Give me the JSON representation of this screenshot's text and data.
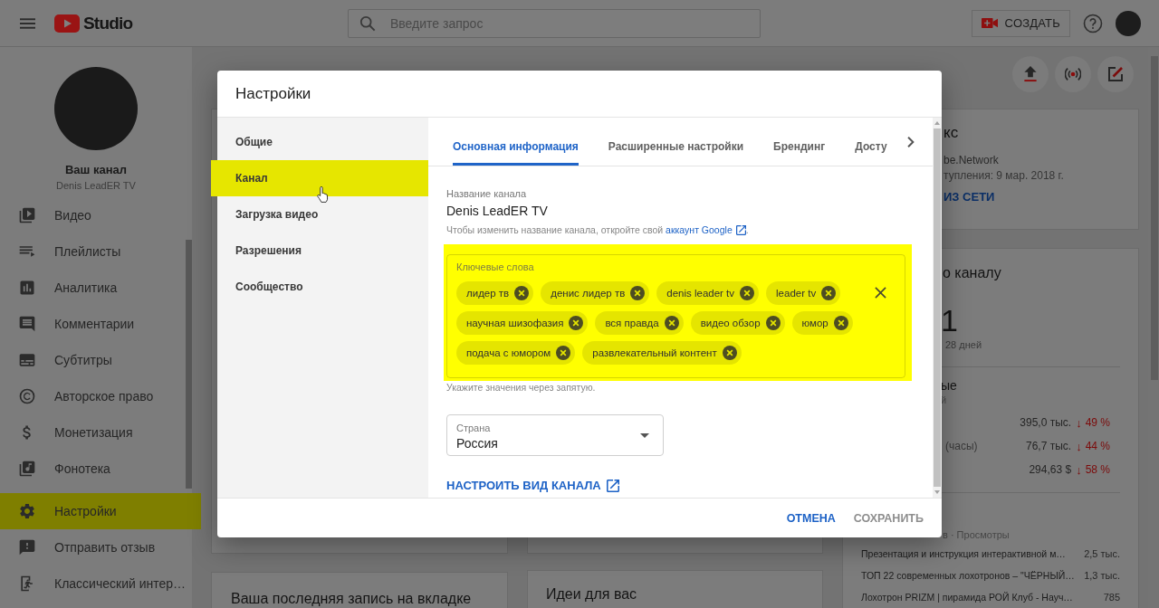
{
  "topbar": {
    "logo_text": "Studio",
    "search": {
      "placeholder": "Введите запрос"
    },
    "create_button": "СОЗДАТЬ"
  },
  "sidebar": {
    "channel_title": "Ваш канал",
    "channel_name": "Denis LeadER TV",
    "items": [
      {
        "label": "Видео",
        "selected": false
      },
      {
        "label": "Плейлисты",
        "selected": false
      },
      {
        "label": "Аналитика",
        "selected": false
      },
      {
        "label": "Комментарии",
        "selected": false
      },
      {
        "label": "Субтитры",
        "selected": false
      },
      {
        "label": "Авторское право",
        "selected": false
      },
      {
        "label": "Монетизация",
        "selected": false
      },
      {
        "label": "Фонотека",
        "selected": false
      }
    ],
    "footer_items": [
      {
        "label": "Настройки",
        "selected": true
      },
      {
        "label": "Отправить отзыв",
        "selected": false
      },
      {
        "label": "Классический интер…",
        "selected": false
      }
    ]
  },
  "dashboard": {
    "channel_card": {
      "title": "кс",
      "network": "be.Network",
      "joined": "тупления: 9 мар. 2018 г.",
      "link": "ИЗ СЕТИ"
    },
    "analytics_card": {
      "title": "о каналу",
      "big_number": "1",
      "period": "28 дней",
      "section_title": "ые",
      "section_subtitle": "й",
      "stats": [
        {
          "value": "395,0 тыс.",
          "arrow": "↓",
          "change": "49 %"
        },
        {
          "label": "(часы)",
          "value": "76,7 тыс.",
          "arrow": "↓",
          "change": "44 %"
        },
        {
          "value": "294,63 $",
          "arrow": "↓",
          "change": "58 %"
        }
      ],
      "videos_header": "в · Просмотры",
      "videos": [
        {
          "title": "Презентация и инструкция интерактивной м…",
          "views": "2,5 тыс."
        },
        {
          "title": "ТОП 22 современных лохотронов – \"ЧЁРНЫЙ…",
          "views": "1,3 тыс."
        },
        {
          "title": "Лохотрон PRIZM | пирамида РОЙ Клуб - Науч…",
          "views": "785"
        }
      ]
    },
    "bottom_cards": [
      {
        "title": "Ваша последняя запись на вкладке"
      },
      {
        "title": "Идеи для вас"
      }
    ]
  },
  "dialog": {
    "title": "Настройки",
    "nav": [
      {
        "label": "Общие",
        "selected": false
      },
      {
        "label": "Канал",
        "selected": true
      },
      {
        "label": "Загрузка видео",
        "selected": false
      },
      {
        "label": "Разрешения",
        "selected": false
      },
      {
        "label": "Сообщество",
        "selected": false
      }
    ],
    "tabs": [
      {
        "label": "Основная информация",
        "selected": true
      },
      {
        "label": "Расширенные настройки",
        "selected": false
      },
      {
        "label": "Брендинг",
        "selected": false
      },
      {
        "label": "Досту",
        "selected": false
      }
    ],
    "channel_name": {
      "label": "Название канала",
      "value": "Denis LeadER TV",
      "hint": "Чтобы изменить название канала, откройте свой",
      "hint_link": "аккаунт Google",
      "hint_end": "."
    },
    "keywords": {
      "label": "Ключевые слова",
      "highlighted": true,
      "chips": [
        "лидер тв",
        "денис лидер тв",
        "denis leader tv",
        "leader tv",
        "научная шизофазия",
        "вся правда",
        "видео обзор",
        "юмор",
        "подача с юмором",
        "развлекательный контент"
      ],
      "hint": "Укажите значения через запятую."
    },
    "country": {
      "label": "Страна",
      "value": "Россия"
    },
    "customize_link": "НАСТРОИТЬ ВИД КАНАЛА",
    "buttons": [
      {
        "label": "ОТМЕНА",
        "disabled": false
      },
      {
        "label": "СОХРАНИТЬ",
        "disabled": true
      }
    ]
  }
}
